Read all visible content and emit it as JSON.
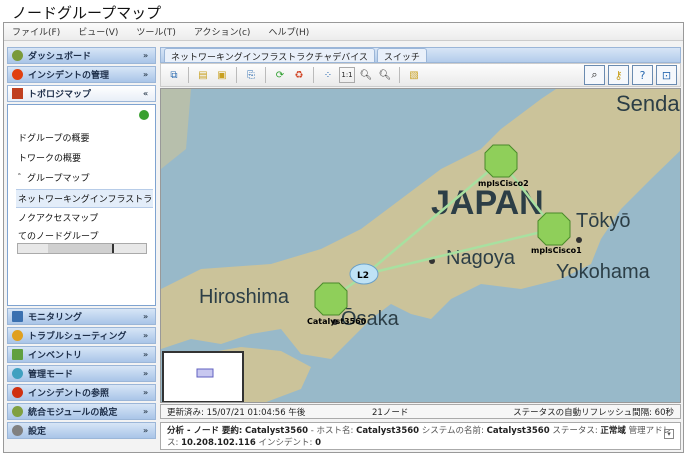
{
  "title": "ノードグループマップ",
  "menu": [
    "ファイル(F)",
    "ビュー(V)",
    "ツール(T)",
    "アクション(c)",
    "ヘルプ(H)"
  ],
  "sidebar": {
    "top": [
      {
        "label": "ダッシュボード",
        "icon": "gauge-icon",
        "color": "#7a9a3a"
      },
      {
        "label": "インシデントの管理",
        "icon": "flame-icon",
        "color": "#e04010"
      }
    ],
    "topology": {
      "label": "トポロジマップ",
      "icon": "topology-icon",
      "refresh_icon": "refresh-icon",
      "items": [
        "ドグループの概要",
        "トワークの概要",
        "゛グループマップ",
        "ネットワーキングインフラストラクチャ",
        "ノクアクセスマップ",
        "てのノードグループ"
      ],
      "selected_index": 3
    },
    "bottom": [
      {
        "label": "モニタリング",
        "icon": "monitor-icon",
        "color": "#3a70b0"
      },
      {
        "label": "トラブルシューティング",
        "icon": "warning-icon",
        "color": "#e0a020"
      },
      {
        "label": "インベントリ",
        "icon": "inventory-icon",
        "color": "#60a040"
      },
      {
        "label": "管理モード",
        "icon": "admin-mode-icon",
        "color": "#40a0c0"
      },
      {
        "label": "インシデントの参照",
        "icon": "incident-browse-icon",
        "color": "#d03010"
      },
      {
        "label": "統合モジュールの設定",
        "icon": "integration-icon",
        "color": "#80a040"
      },
      {
        "label": "設定",
        "icon": "wrench-icon",
        "color": "#808080"
      }
    ]
  },
  "tabs": [
    "ネットワーキングインフラストラクチャデバイス",
    "スイッチ"
  ],
  "map": {
    "places": [
      "Sendai",
      "JAPAN",
      "Tōkyō",
      "Yokohama",
      "Nagoya",
      "Ōsaka",
      "Hiroshima"
    ],
    "nodes": {
      "n1": "mplsCisco2",
      "n2": "mplsCisco1",
      "n3": "Catalyst3560",
      "cloud": "L2"
    },
    "node_color": "#8fcf5a",
    "link_color": "#a8e0a0"
  },
  "status": {
    "updated": "更新済み: 15/07/21 01:04:56 午後",
    "nodes": "21ノード",
    "refresh": "ステータスの自動リフレッシュ間隔: 60秒"
  },
  "details": {
    "p1": "分析 - ノード 要約:",
    "host_val": "Catalyst3560",
    "p2": " - ホスト名:",
    "p3": " システムの名前:",
    "p4": " ステータス:",
    "status_val": "正常域",
    "p5": " 管理アドレス:",
    "addr": "10.208.102.116",
    "p6": " インシデント:",
    "inc": "0"
  }
}
